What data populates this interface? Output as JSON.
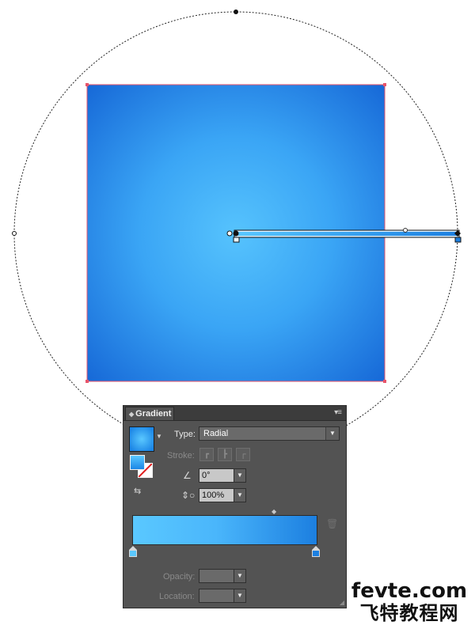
{
  "gradient_panel": {
    "tab_title": "Gradient",
    "type_label": "Type:",
    "type_value": "Radial",
    "stroke_label": "Stroke:",
    "angle_value": "0°",
    "aspect_value": "100%",
    "opacity_label": "Opacity:",
    "location_label": "Location:"
  },
  "colors": {
    "gradient_start": "#5ac8ff",
    "gradient_end": "#1c7fe0",
    "selection_box": "#e8546a",
    "panel_bg": "#535353"
  },
  "watermark": {
    "line1": "fevte.com",
    "line2": "飞特教程网"
  }
}
